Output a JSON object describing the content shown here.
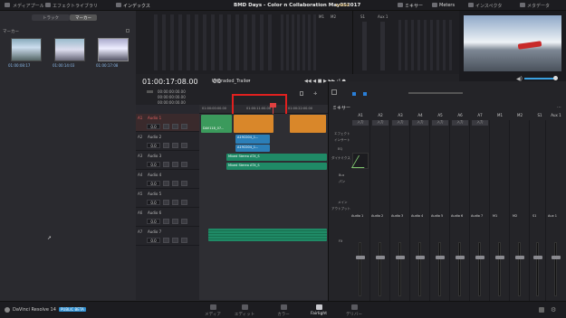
{
  "topbar": {
    "media_pool": "メディアプール",
    "effects_library": "エフェクトライブラリ",
    "index": "インデックス",
    "project_title": "BMD Days - Color n Collaboration May052017",
    "edited_badge": "Edited",
    "mixer": "ミキサー",
    "meters": "Meters",
    "inspector": "インスペクタ",
    "metadata": "メタデータ"
  },
  "media_panel": {
    "tab_tracks": "トラック",
    "tab_markers": "マーカー",
    "section_label": "マーカー",
    "thumbnails": [
      {
        "timecode": "01:00:08:17"
      },
      {
        "timecode": "01:00:14:03"
      },
      {
        "timecode": "01:00:17:08"
      }
    ]
  },
  "timeline": {
    "current_timecode": "01:00:17:08.00",
    "sub_timecode": "00",
    "name": "Ungraded_Trailer",
    "ruler_rows": [
      "00:00:00:00.00",
      "00:00:00:00.00",
      "00:00:00:00.00"
    ],
    "ruler_ticks": [
      "01:00:00:00.00",
      "01:00:11:00.00",
      "01:00:22:00.00"
    ],
    "tracks": [
      {
        "name": "Audio 1",
        "id": "A1",
        "vol": "0.0"
      },
      {
        "name": "Audio 2",
        "id": "A2",
        "vol": "0.0"
      },
      {
        "name": "Audio 3",
        "id": "A3",
        "vol": "0.0"
      },
      {
        "name": "Audio 4",
        "id": "A4",
        "vol": "0.0"
      },
      {
        "name": "Audio 5",
        "id": "A5",
        "vol": "0.0"
      },
      {
        "name": "Audio 6",
        "id": "A6",
        "vol": "0.0"
      },
      {
        "name": "Audio 7",
        "id": "A7",
        "vol": "0.0"
      }
    ],
    "clips": {
      "a1_left": "DAV118_07...",
      "a2": "A19C004_1...",
      "a3": "A19C004_1...",
      "a3_green": "Mixed Stereo ATX_S",
      "a4_green": "Mixed Stereo ATX_S"
    }
  },
  "mixer": {
    "title": "ミキサー",
    "columns": [
      "A1",
      "A2",
      "A3",
      "A4",
      "A5",
      "A6",
      "A7",
      "M1",
      "M2",
      "S1",
      "Aux 1"
    ],
    "labels": {
      "input": "入力",
      "effects": "エフェクト",
      "insert": "インサート",
      "eq": "EQ",
      "dynamics": "ダイナミクス",
      "bus_send": "Bus",
      "pan": "パン",
      "main": "メイン",
      "output": "アウトプット",
      "fx": "FX"
    },
    "channel_names": [
      "Audio 1",
      "Audio 2",
      "Audio 3",
      "Audio 4",
      "Audio 5",
      "Audio 6",
      "Audio 7",
      "M1",
      "M2",
      "S1",
      "Aux 1"
    ],
    "input_btn": "入力"
  },
  "meters_top": {
    "labels": [
      "M1",
      "M2",
      "S1",
      "Aux 1"
    ]
  },
  "bottom": {
    "app_name": "DaVinci Resolve 14",
    "badge": "PUBLIC BETA",
    "tabs": [
      "メディア",
      "エディット",
      "カラー",
      "Fairlight",
      "デリバー"
    ]
  }
}
